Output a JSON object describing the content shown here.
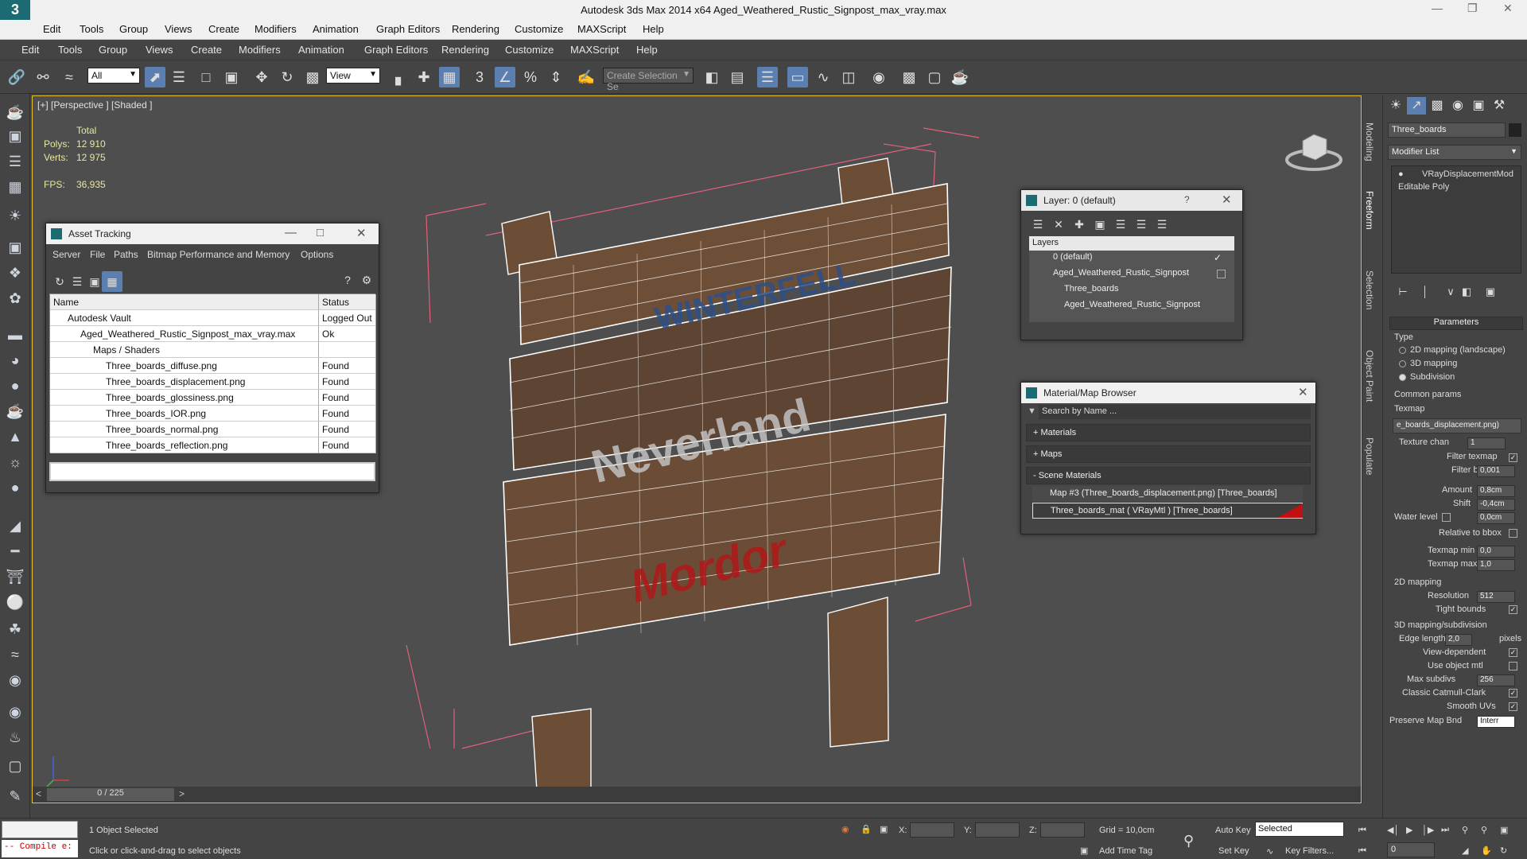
{
  "app": {
    "title": "Autodesk 3ds Max  2014 x64    Aged_Weathered_Rustic_Signpost_max_vray.max",
    "logo": "3ds-max-logo-icon",
    "title_menu": [
      "Edit",
      "Tools",
      "Group",
      "Views",
      "Create",
      "Modifiers",
      "Animation",
      "Graph Editors",
      "Rendering",
      "Customize",
      "MAXScript",
      "Help"
    ]
  },
  "menu": [
    "Edit",
    "Tools",
    "Group",
    "Views",
    "Create",
    "Modifiers",
    "Animation",
    "Graph Editors",
    "Rendering",
    "Customize",
    "MAXScript",
    "Help"
  ],
  "toolbar": {
    "selection_filter": "All",
    "ref_coord": "View",
    "named_selection_placeholder": "Create Selection Se",
    "snap_3": "3"
  },
  "viewport": {
    "label": "[+] [Perspective ] [Shaded ]",
    "stats": {
      "total_label": "Total",
      "polys_label": "Polys:",
      "polys": "12 910",
      "verts_label": "Verts:",
      "verts": "12 975",
      "fps_label": "FPS:",
      "fps": "36,935"
    },
    "sign_text": {
      "top": "WINTERFELL",
      "mid": "Neverland",
      "bottom": "Mordor"
    },
    "time_slider": "0 / 225"
  },
  "asset_tracking": {
    "title": "Asset Tracking",
    "menu": [
      "Server",
      "File",
      "Paths",
      "Bitmap Performance and Memory",
      "Options"
    ],
    "columns": [
      "Name",
      "Status"
    ],
    "rows": [
      {
        "name": "Autodesk Vault",
        "status": "Logged Out",
        "indent": 1
      },
      {
        "name": "Aged_Weathered_Rustic_Signpost_max_vray.max",
        "status": "Ok",
        "indent": 2
      },
      {
        "name": "Maps / Shaders",
        "status": "",
        "indent": 3
      },
      {
        "name": "Three_boards_diffuse.png",
        "status": "Found",
        "indent": 4
      },
      {
        "name": "Three_boards_displacement.png",
        "status": "Found",
        "indent": 4
      },
      {
        "name": "Three_boards_glossiness.png",
        "status": "Found",
        "indent": 4
      },
      {
        "name": "Three_boards_IOR.png",
        "status": "Found",
        "indent": 4
      },
      {
        "name": "Three_boards_normal.png",
        "status": "Found",
        "indent": 4
      },
      {
        "name": "Three_boards_reflection.png",
        "status": "Found",
        "indent": 4
      }
    ]
  },
  "layer_window": {
    "title": "Layer: 0 (default)",
    "help": "?",
    "header": "Layers",
    "rows": [
      {
        "name": "0 (default)",
        "indent": 1
      },
      {
        "name": "Aged_Weathered_Rustic_Signpost",
        "indent": 1
      },
      {
        "name": "Three_boards",
        "indent": 2
      },
      {
        "name": "Aged_Weathered_Rustic_Signpost",
        "indent": 2
      }
    ]
  },
  "material_browser": {
    "title": "Material/Map Browser",
    "search_placeholder": "Search by Name ...",
    "groups": [
      "+ Materials",
      "+ Maps",
      "- Scene Materials"
    ],
    "items": [
      "Map #3 (Three_boards_displacement.png) [Three_boards]",
      "Three_boards_mat  ( VRayMtl ) [Three_boards]"
    ]
  },
  "ribbon_tabs": [
    "Modeling",
    "Freeform",
    "Selection",
    "Object Paint",
    "Populate"
  ],
  "command_panel": {
    "object_name": "Three_boards",
    "modifier_list": "Modifier List",
    "stack": [
      "VRayDisplacementMod",
      "Editable Poly"
    ],
    "rollout": "Parameters",
    "type_label": "Type",
    "types": [
      "2D mapping (landscape)",
      "3D mapping",
      "Subdivision"
    ],
    "selected_type": 2,
    "common_label": "Common params",
    "texmap_label": "Texmap",
    "texmap_value": "e_boards_displacement.png)",
    "texture_chan_label": "Texture chan",
    "texture_chan": "1",
    "filter_texmap": "Filter texmap",
    "filter_blur_label": "Filter blur",
    "filter_blur": "0,001",
    "amount_label": "Amount",
    "amount": "0,8cm",
    "shift_label": "Shift",
    "shift": "-0,4cm",
    "water_label": "Water level",
    "water": "0,0cm",
    "relative_bbox": "Relative to bbox",
    "texmap_min_label": "Texmap min",
    "texmap_min": "0,0",
    "texmap_max_label": "Texmap max",
    "texmap_max": "1,0",
    "mapping2d_label": "2D mapping",
    "resolution_label": "Resolution",
    "resolution": "512",
    "tight_bounds": "Tight bounds",
    "mapping3d_label": "3D mapping/subdivision",
    "edge_length_label": "Edge length",
    "edge_length": "2,0",
    "pixels": "pixels",
    "view_dependent": "View-dependent",
    "use_object_mtl": "Use object mtl",
    "max_subdivs_label": "Max subdivs",
    "max_subdivs": "256",
    "classic_catmull": "Classic Catmull-Clark",
    "smooth_uvs": "Smooth UVs",
    "preserve_map_label": "Preserve Map Bnd",
    "preserve_map": "Interr"
  },
  "status": {
    "maxscript": "-- Compile e:",
    "selected": "1 Object Selected",
    "prompt": "Click or click-and-drag to select objects",
    "x_label": "X:",
    "y_label": "Y:",
    "z_label": "Z:",
    "grid": "Grid = 10,0cm",
    "add_time_tag": "Add Time Tag",
    "auto_key": "Auto Key",
    "set_key": "Set Key",
    "key_mode": "Selected",
    "key_filters": "Key Filters...",
    "frame": "0"
  },
  "colors": {
    "accent": "#5b7fb0",
    "viewport_border": "#e6c12b",
    "wire": "#ffffff",
    "bbox": "#e0607a",
    "wood": "#6b4e35"
  }
}
